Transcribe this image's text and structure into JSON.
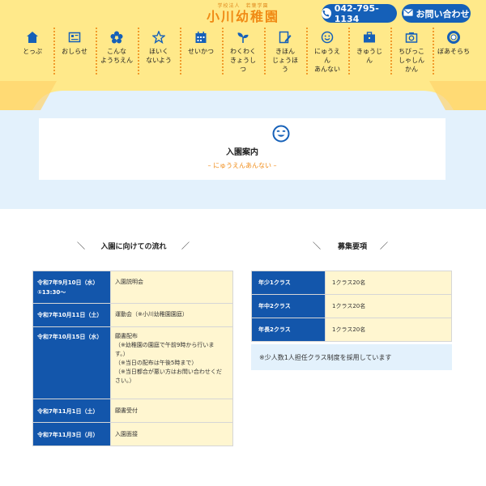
{
  "header": {
    "logo_sub": "学校法人　若葉学園",
    "logo_main": "小川幼稚園",
    "tel_label": "042-795-1134",
    "contact_label": "お問い合わせ",
    "tel_icon": "phone-icon",
    "mail_icon": "mail-icon",
    "bg_color": "#ffe98a",
    "accent_color": "#f08a14",
    "button_color": "#1560b8"
  },
  "nav": {
    "items": [
      {
        "label": "とっぷ",
        "icon": "home-icon"
      },
      {
        "label": "おしらせ",
        "icon": "news-icon"
      },
      {
        "label": "こんな\nようちえん",
        "icon": "flower-icon"
      },
      {
        "label": "ほいく\nないよう",
        "icon": "star-icon"
      },
      {
        "label": "せいかつ",
        "icon": "calendar-icon"
      },
      {
        "label": "わくわく\nきょうし\nつ",
        "icon": "sprout-icon"
      },
      {
        "label": "きほん\nじょうほ\nう",
        "icon": "document-pen-icon"
      },
      {
        "label": "にゅうえ\nん\nあんない",
        "icon": "smile-icon"
      },
      {
        "label": "きゅうじ\nん",
        "icon": "briefcase-icon"
      },
      {
        "label": "ちびっこ\nしゃしん\nかん",
        "icon": "camera-icon"
      },
      {
        "label": "ぼあそらち",
        "icon": "life-ring-icon"
      }
    ]
  },
  "hero": {
    "title": "入園案内",
    "ruby": "– にゅうえんあんない –",
    "icon": "smile-face-icon",
    "bg_color": "#e3f1fc"
  },
  "flow": {
    "heading": "入園に向けての流れ",
    "rows": [
      {
        "date": "令和7年9月10日（水）\n①13:30〜",
        "lines": [
          "入園説明会"
        ]
      },
      {
        "date": "令和7年10月11日（土）",
        "lines": [
          "運動会（※小川幼稚園園庭）"
        ]
      },
      {
        "date": "令和7年10月15日（水）",
        "lines": [
          "願書配布",
          "（※幼稚園の園庭で午前9時から行いま",
          "す。）",
          "（※当日の配布は午後5時まで）",
          "（※当日都合が悪い方はお問い合わせくだ",
          "さい。）"
        ]
      },
      {
        "date": "令和7年11月1日（土）",
        "lines": [
          "願書受付"
        ]
      },
      {
        "date": "令和7年11月3日（月）",
        "lines": [
          "入園面接"
        ]
      }
    ]
  },
  "recruit": {
    "heading": "募集要項",
    "rows": [
      {
        "class": "年少1クラス",
        "detail": "1クラス20名"
      },
      {
        "class": "年中2クラス",
        "detail": "1クラス20名"
      },
      {
        "class": "年長2クラス",
        "detail": "1クラス20名"
      }
    ],
    "note": "※少人数1人担任クラス制度を採用しています"
  }
}
